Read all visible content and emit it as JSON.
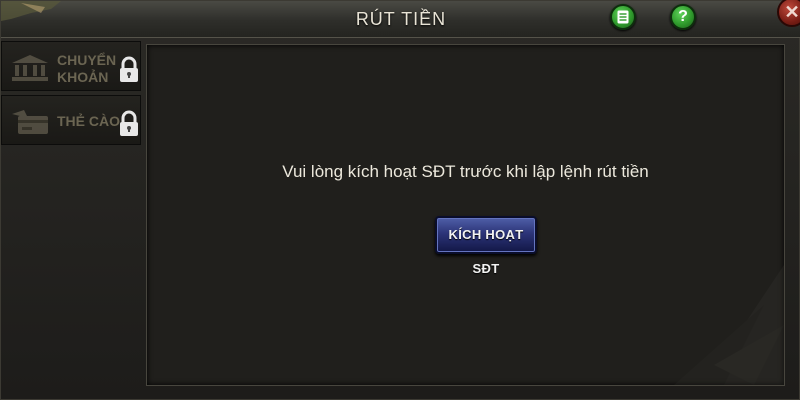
{
  "header": {
    "title": "RÚT TIỀN"
  },
  "toolbar": {
    "history_icon": "document-list-icon",
    "help_label": "?",
    "close_label": "✕"
  },
  "sidebar": {
    "items": [
      {
        "label": "CHUYỂN KHOẢN",
        "icon": "bank-icon",
        "locked": true
      },
      {
        "label": "THẺ CÀO",
        "icon": "card-icon",
        "locked": true
      }
    ]
  },
  "main": {
    "message": "Vui lòng kích hoạt SĐT trước khi lập lệnh rút tiền",
    "button_label": "KÍCH HOẠT SĐT"
  },
  "colors": {
    "title": "#e9e4d6",
    "button": "#2c3478",
    "header_buttons": "#2f9a2c",
    "close": "#7a1e15"
  }
}
